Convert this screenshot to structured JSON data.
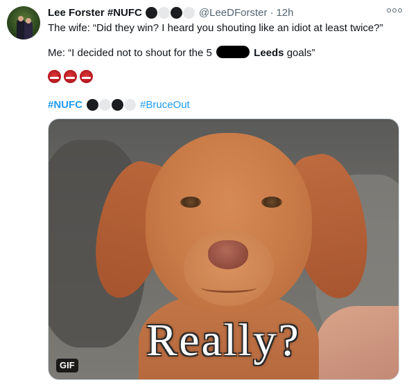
{
  "tweet": {
    "display_name": "Lee Forster #NUFC",
    "handle": "@LeeDForster",
    "separator": "·",
    "time": "12h",
    "name_badges": [
      "#1b1d20",
      "#e6e8ea",
      "#1b1d20",
      "#e6e8ea"
    ],
    "line1": "The wife: “Did they win? I heard you shouting like an idiot at least twice?”",
    "line2": {
      "before": "Me: “I decided not to shout for the 5",
      "bold": "Leeds",
      "after": "goals”"
    },
    "emojis": [
      "red-angry-face",
      "red-angry-face",
      "red-angry-face"
    ],
    "hashtag1": "#NUFC",
    "hashtag_badges": [
      "#1b1d20",
      "#e6e8ea",
      "#1b1d20",
      "#e6e8ea"
    ],
    "hashtag2": "#BruceOut",
    "media": {
      "caption": "Really?",
      "badge": "GIF"
    }
  },
  "colors": {
    "text": "#0f1419",
    "muted": "#536471",
    "link": "#1d9bf0"
  }
}
